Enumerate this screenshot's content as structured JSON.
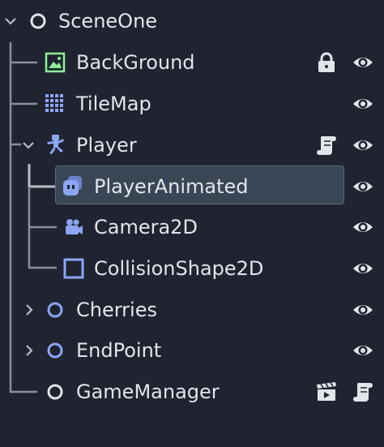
{
  "scene_tree": {
    "nodes": [
      {
        "id": "SceneOne",
        "label": "SceneOne",
        "type": "Node2D",
        "expanded": true
      },
      {
        "id": "BackGround",
        "label": "BackGround",
        "type": "Sprite2D",
        "locked": true
      },
      {
        "id": "TileMap",
        "label": "TileMap",
        "type": "TileMap"
      },
      {
        "id": "Player",
        "label": "Player",
        "type": "CharacterBody2D",
        "expanded": true,
        "has_script": true
      },
      {
        "id": "PlayerAnimated",
        "label": "PlayerAnimated",
        "type": "AnimatedSprite2D",
        "selected": true
      },
      {
        "id": "Camera2D",
        "label": "Camera2D",
        "type": "Camera2D"
      },
      {
        "id": "CollisionShape2D",
        "label": "CollisionShape2D",
        "type": "CollisionShape2D"
      },
      {
        "id": "Cherries",
        "label": "Cherries",
        "type": "Node2D",
        "expanded": false
      },
      {
        "id": "EndPoint",
        "label": "EndPoint",
        "type": "Node2D",
        "expanded": false
      },
      {
        "id": "GameManager",
        "label": "GameManager",
        "type": "Node",
        "has_script": true,
        "has_clapper": true
      }
    ]
  },
  "colors": {
    "background": "#1f2430",
    "text": "#e2e5ea",
    "node2d_icon": "#8da5f3",
    "sprite_icon": "#8eef97",
    "node_icon": "#e2e5ea",
    "selection_bg": "#3a4656",
    "tree_lines": "#8a8f98"
  },
  "icons": {
    "eye": "eye-icon",
    "lock": "lock-icon",
    "script": "script-icon",
    "clapper": "clapperboard-icon",
    "expand": "chevron-down-icon",
    "collapse": "chevron-right-icon"
  }
}
